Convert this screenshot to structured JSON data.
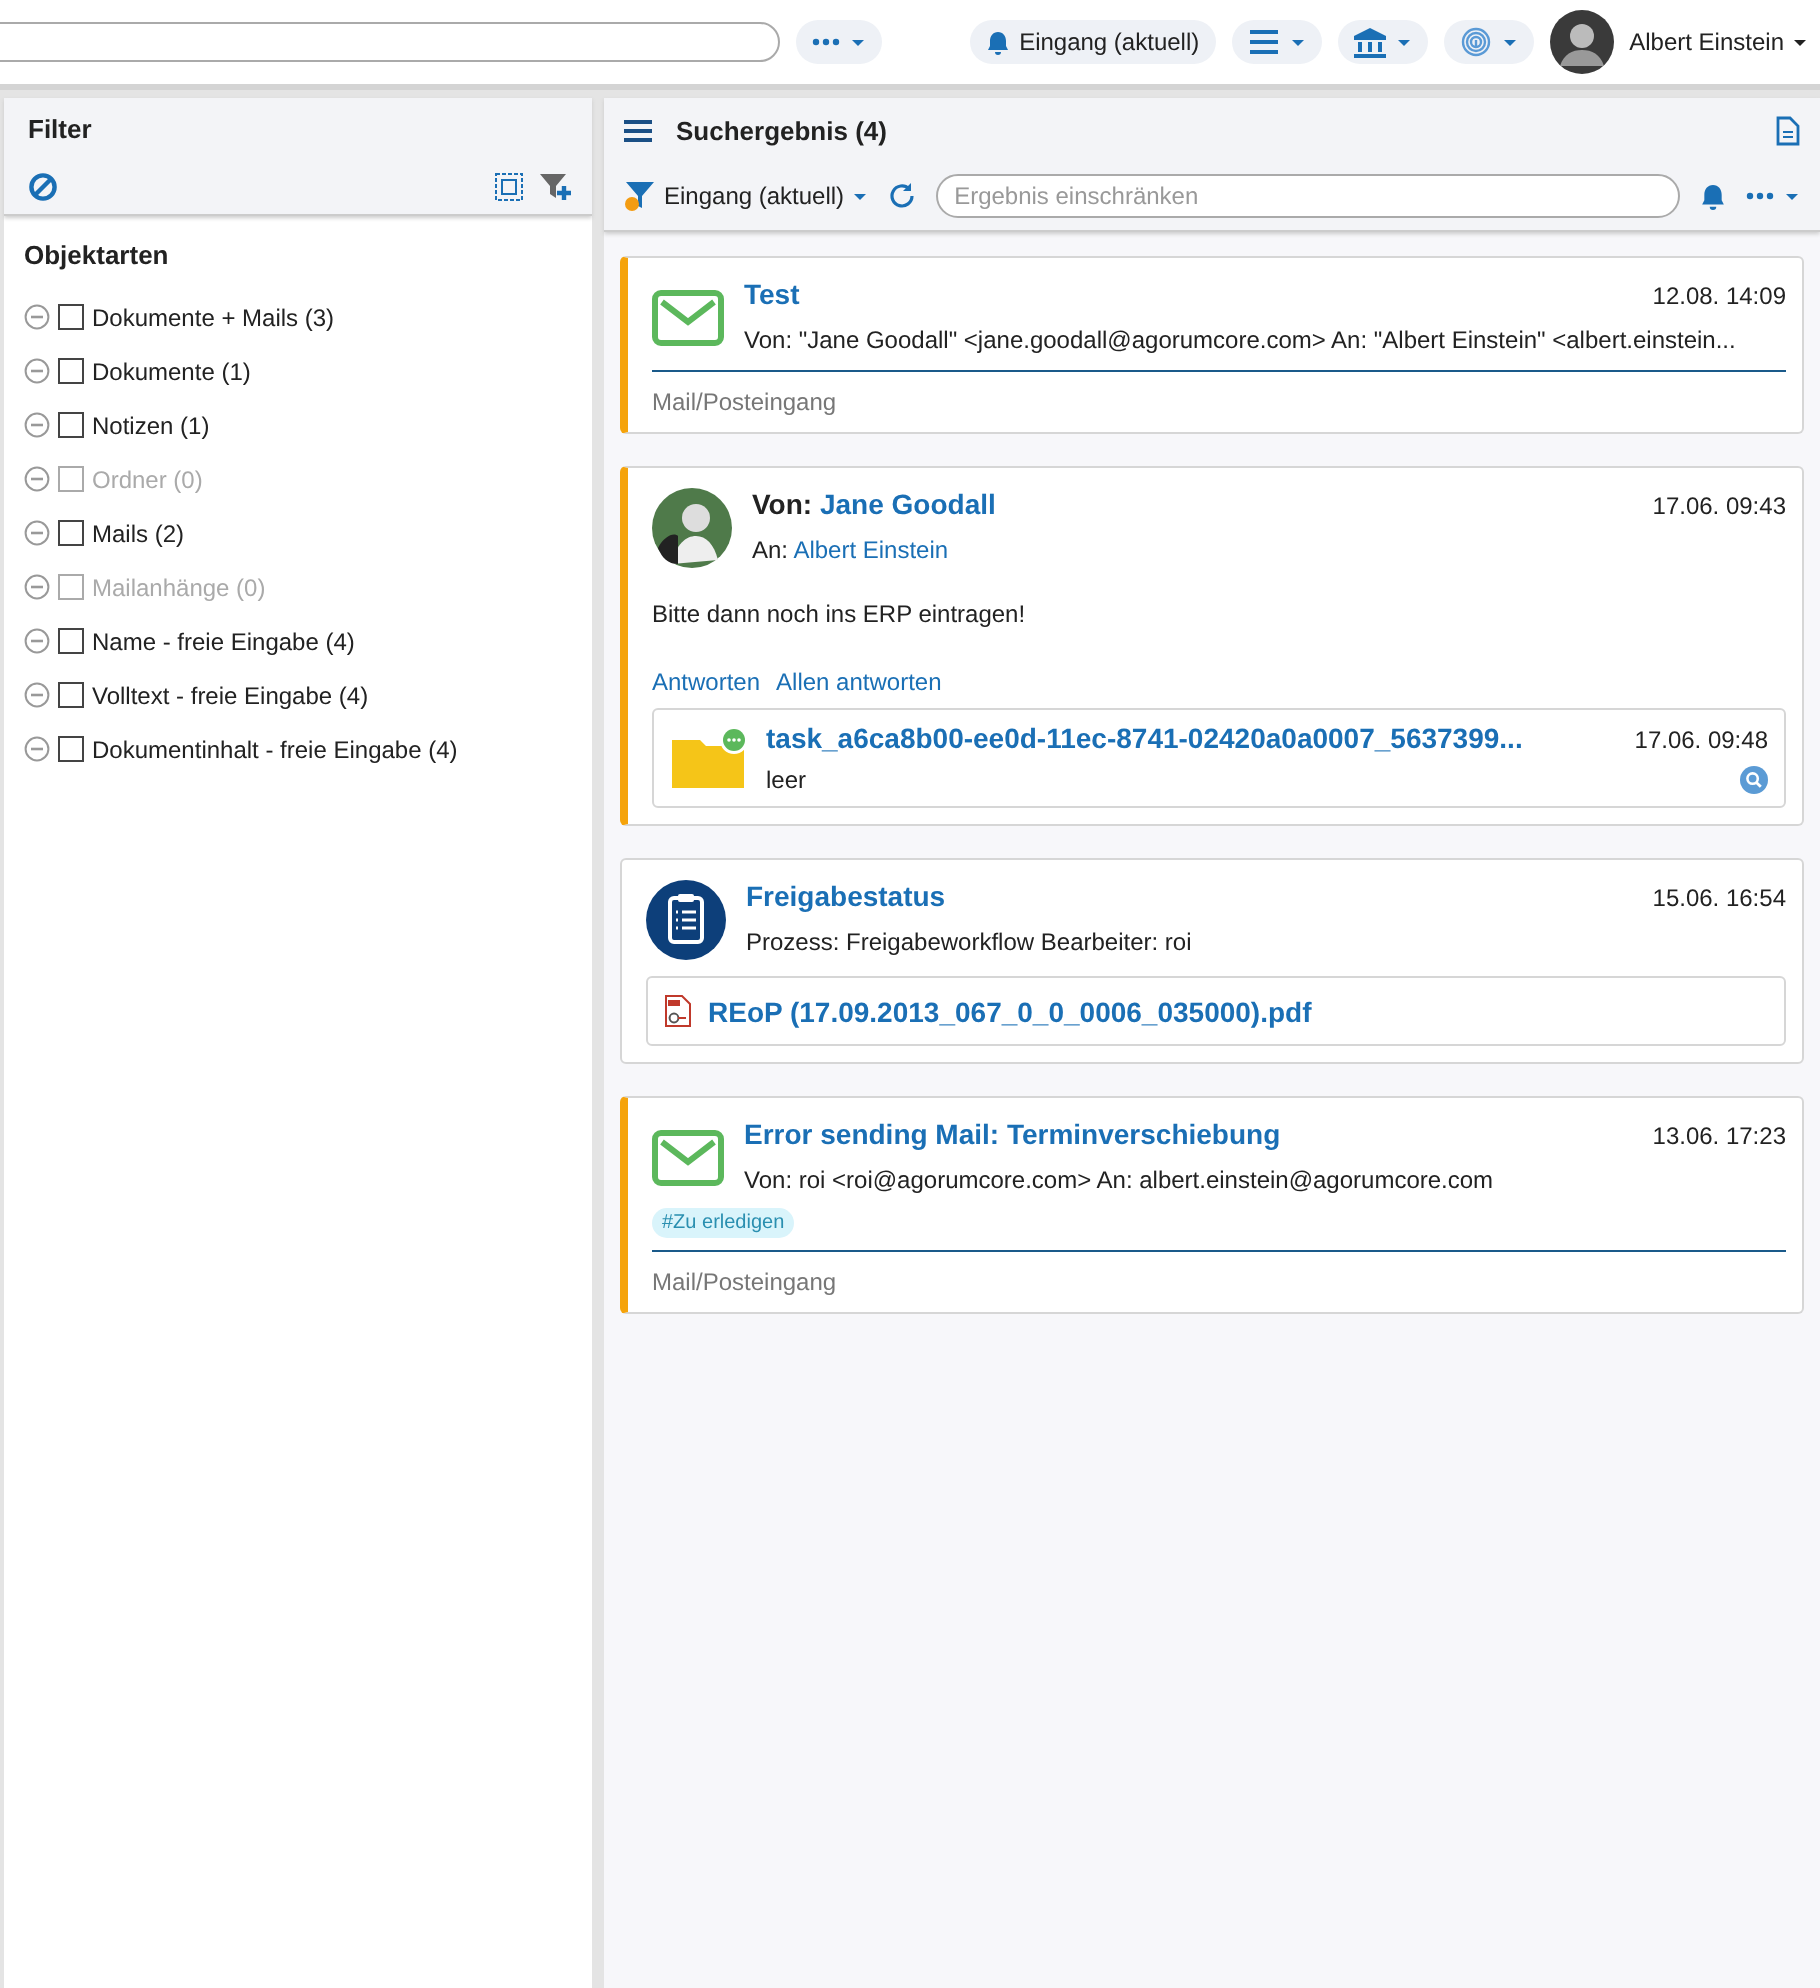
{
  "topbar": {
    "inbox_button": "Eingang (aktuell)",
    "user": "Albert Einstein"
  },
  "filter": {
    "title": "Filter",
    "section": "Objektarten",
    "items": [
      {
        "label": "Dokumente + Mails (3)",
        "checked": false,
        "disabled": false
      },
      {
        "label": "Dokumente (1)",
        "checked": false,
        "disabled": false
      },
      {
        "label": "Notizen (1)",
        "checked": false,
        "disabled": false
      },
      {
        "label": "Ordner (0)",
        "checked": false,
        "disabled": true
      },
      {
        "label": "Mails (2)",
        "checked": false,
        "disabled": false
      },
      {
        "label": "Mailanhänge (0)",
        "checked": false,
        "disabled": true
      },
      {
        "label": "Name - freie Eingabe (4)",
        "checked": false,
        "disabled": false
      },
      {
        "label": "Volltext - freie Eingabe (4)",
        "checked": false,
        "disabled": false
      },
      {
        "label": "Dokumentinhalt - freie Eingabe (4)",
        "checked": false,
        "disabled": false
      }
    ]
  },
  "results": {
    "title": "Suchergebnis (4)",
    "scope": "Eingang (aktuell)",
    "search": {
      "placeholder": "Ergebnis einschränken"
    },
    "cards": [
      {
        "kind": "mail",
        "highlighted": true,
        "title": "Test",
        "time": "12.08. 14:09",
        "meta": "Von: \"Jane Goodall\" <jane.goodall@agorumcore.com>   An: \"Albert Einstein\" <albert.einstein...",
        "path": "Mail/Posteingang"
      },
      {
        "kind": "message",
        "highlighted": true,
        "from_label": "Von:",
        "from": "Jane Goodall",
        "to_label": "An:",
        "to": "Albert Einstein",
        "time": "17.06. 09:43",
        "body": "Bitte dann noch ins ERP eintragen!",
        "actions": [
          "Antworten",
          "Allen antworten"
        ],
        "attachment": {
          "title": "task_a6ca8b00-ee0d-11ec-8741-02420a0a0007_5637399...",
          "subtitle": "leer",
          "time": "17.06. 09:48"
        }
      },
      {
        "kind": "workflow",
        "highlighted": false,
        "title": "Freigabestatus",
        "time": "15.06. 16:54",
        "meta": "Prozess: Freigabeworkflow  Bearbeiter: roi",
        "document": "REoP (17.09.2013_067_0_0_0006_035000).pdf"
      },
      {
        "kind": "mail",
        "highlighted": true,
        "title": "Error sending Mail: Terminverschiebung",
        "time": "13.06. 17:23",
        "meta": "Von: roi <roi@agorumcore.com>   An: albert.einstein@agorumcore.com",
        "tags": [
          "#Zu erledigen"
        ],
        "path": "Mail/Posteingang"
      }
    ]
  }
}
